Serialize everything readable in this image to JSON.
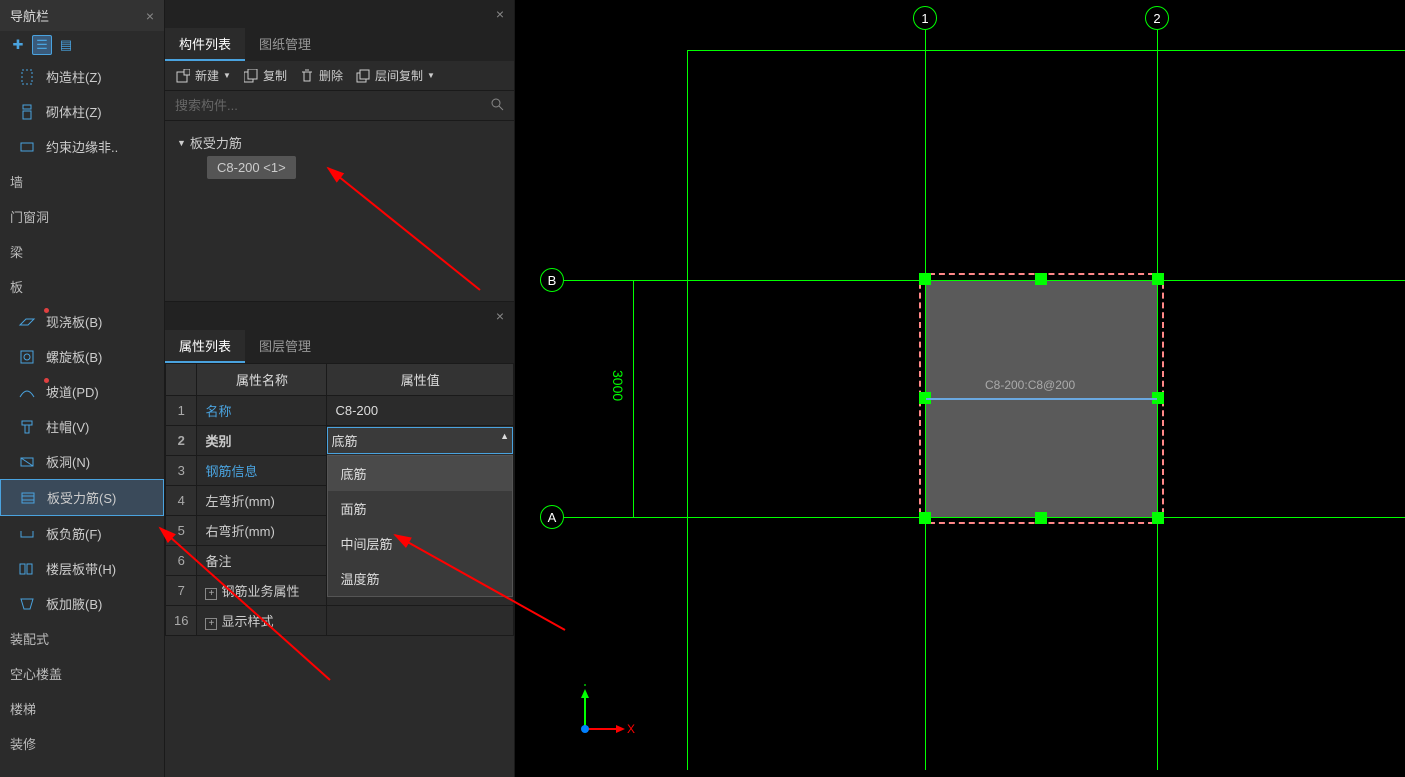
{
  "nav": {
    "title": "导航栏",
    "items_top": [
      {
        "label": "构造柱(Z)",
        "icon": "column"
      },
      {
        "label": "砌体柱(Z)",
        "icon": "mason-column"
      },
      {
        "label": "约束边缘非..",
        "icon": "edge"
      }
    ],
    "categories": [
      "墙",
      "门窗洞",
      "梁",
      "板"
    ],
    "slab_items": [
      {
        "label": "现浇板(B)",
        "red_dot": true
      },
      {
        "label": "螺旋板(B)"
      },
      {
        "label": "坡道(PD)",
        "red_dot": true
      },
      {
        "label": "柱帽(V)"
      },
      {
        "label": "板洞(N)"
      },
      {
        "label": "板受力筋(S)",
        "selected": true
      },
      {
        "label": "板负筋(F)"
      },
      {
        "label": "楼层板带(H)"
      },
      {
        "label": "板加腋(B)"
      }
    ],
    "categories_bottom": [
      "装配式",
      "空心楼盖",
      "楼梯",
      "装修"
    ]
  },
  "comp": {
    "tabs": [
      {
        "label": "构件列表",
        "active": true
      },
      {
        "label": "图纸管理"
      }
    ],
    "toolbar": {
      "new": "新建",
      "copy": "复制",
      "delete": "删除",
      "layer_copy": "层间复制"
    },
    "search_placeholder": "搜索构件...",
    "tree": {
      "parent": "板受力筋",
      "child": "C8-200 <1>"
    }
  },
  "prop": {
    "tabs": [
      {
        "label": "属性列表",
        "active": true
      },
      {
        "label": "图层管理"
      }
    ],
    "header_name": "属性名称",
    "header_val": "属性值",
    "rows": [
      {
        "num": "1",
        "name": "名称",
        "val": "C8-200",
        "name_blue": true
      },
      {
        "num": "2",
        "name": "类别",
        "val": "底筋",
        "dropdown": true,
        "bold": true
      },
      {
        "num": "3",
        "name": "钢筋信息",
        "val": "",
        "name_blue": true
      },
      {
        "num": "4",
        "name": "左弯折(mm)",
        "val": ""
      },
      {
        "num": "5",
        "name": "右弯折(mm)",
        "val": ""
      },
      {
        "num": "6",
        "name": "备注",
        "val": ""
      },
      {
        "num": "7",
        "name": "钢筋业务属性",
        "val": "",
        "expand": true
      },
      {
        "num": "16",
        "name": "显示样式",
        "val": "",
        "expand": true
      }
    ],
    "dropdown_options": [
      "底筋",
      "面筋",
      "中间层筋",
      "温度筋"
    ]
  },
  "canvas": {
    "grid_cols": [
      "1",
      "2"
    ],
    "grid_rows": [
      "B",
      "A"
    ],
    "dim_vertical": "3000",
    "rebar_label": "C8-200:C8@200",
    "axis_x": "X",
    "axis_y": "Y"
  }
}
